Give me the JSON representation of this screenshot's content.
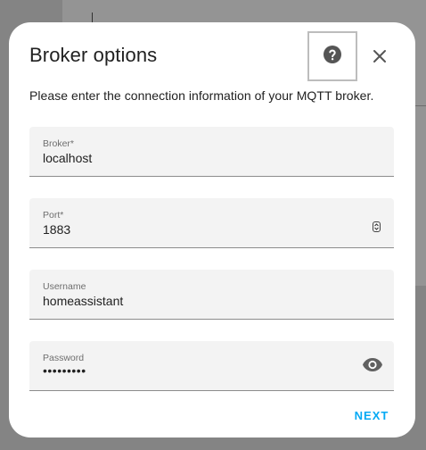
{
  "dialog": {
    "title": "Broker options",
    "description": "Please enter the connection information of your MQTT broker."
  },
  "icons": {
    "help": "help-circle-icon",
    "close": "close-icon",
    "password_visibility": "eye-icon",
    "port_stepper": "spin-stepper-icon"
  },
  "fields": {
    "broker": {
      "label": "Broker*",
      "value": "localhost"
    },
    "port": {
      "label": "Port*",
      "value": "1883"
    },
    "username": {
      "label": "Username",
      "value": "homeassistant"
    },
    "password": {
      "label": "Password",
      "value": "•••••••••"
    }
  },
  "actions": {
    "next_label": "NEXT"
  },
  "colors": {
    "accent": "#03a9f4",
    "field_background": "#f3f3f3",
    "text": "#212121"
  }
}
